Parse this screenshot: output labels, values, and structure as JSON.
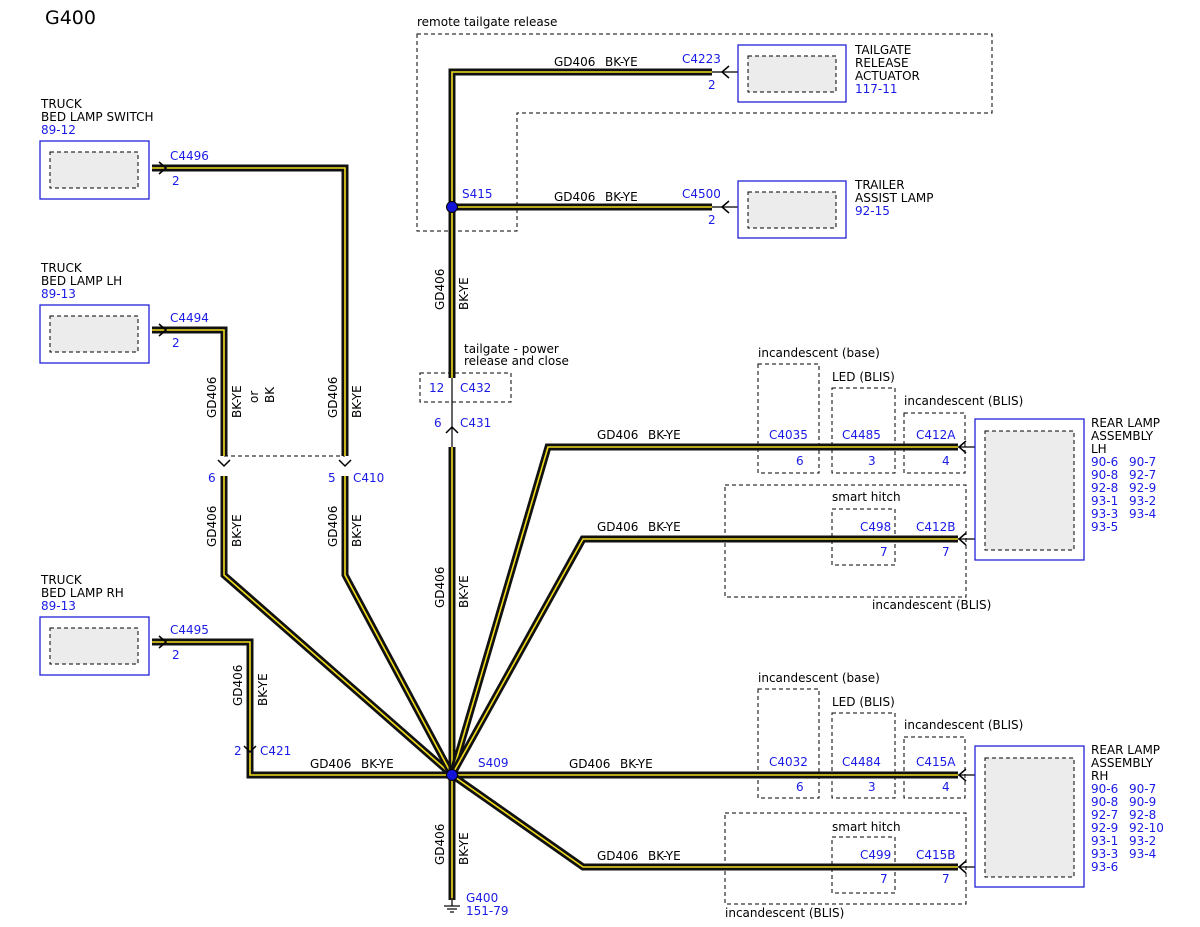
{
  "diagram": {
    "title": "G400",
    "wire_circuit": "GD406",
    "wire_color": "BK-YE",
    "wire_color_alt": "BK",
    "wire_or": "or",
    "accent_blue": "#1a1ae6",
    "wire_yellow": "#f2dc1e"
  },
  "components": {
    "bed_lamp_switch": {
      "name1": "TRUCK",
      "name2": "BED LAMP SWITCH",
      "ref": "89-12",
      "connector": "C4496",
      "pin": "2"
    },
    "bed_lamp_lh": {
      "name1": "TRUCK",
      "name2": "BED LAMP LH",
      "ref": "89-13",
      "connector": "C4494",
      "pin": "2"
    },
    "bed_lamp_rh": {
      "name1": "TRUCK",
      "name2": "BED LAMP RH",
      "ref": "89-13",
      "connector": "C4495",
      "pin": "2"
    },
    "tailgate_actuator": {
      "name1": "TAILGATE",
      "name2": "RELEASE",
      "name3": "ACTUATOR",
      "ref": "117-11",
      "connector": "C4223",
      "pin": "2"
    },
    "trailer_assist_lamp": {
      "name1": "TRAILER",
      "name2": "ASSIST LAMP",
      "ref": "92-15",
      "connector": "C4500",
      "pin": "2"
    },
    "rear_lamp_lh": {
      "name1": "REAR LAMP",
      "name2": "ASSEMBLY",
      "name3": "LH",
      "refs": [
        "90-6",
        "90-7",
        "90-8",
        "92-7",
        "92-8",
        "92-9",
        "93-1",
        "93-2",
        "93-3",
        "93-4",
        "93-5"
      ]
    },
    "rear_lamp_rh": {
      "name1": "REAR LAMP",
      "name2": "ASSEMBLY",
      "name3": "RH",
      "refs": [
        "90-6",
        "90-7",
        "90-8",
        "90-9",
        "92-7",
        "92-8",
        "92-9",
        "92-10",
        "93-1",
        "93-2",
        "93-3",
        "93-4",
        "93-6"
      ]
    }
  },
  "connectors": {
    "c410": {
      "label": "C410",
      "pin_left": "6",
      "pin_right": "5"
    },
    "c432": {
      "label": "C432",
      "pin": "12"
    },
    "c431": {
      "label": "C431",
      "pin": "6"
    },
    "c421": {
      "label": "C421",
      "pin": "2"
    },
    "lh_upper": {
      "c1": "C4035",
      "p1": "6",
      "c2": "C4485",
      "p2": "3",
      "c3": "C412A",
      "p3": "4"
    },
    "lh_lower": {
      "c1": "C498",
      "p1": "7",
      "c2": "C412B",
      "p2": "7"
    },
    "rh_upper": {
      "c1": "C4032",
      "p1": "6",
      "c2": "C4484",
      "p2": "3",
      "c3": "C415A",
      "p3": "4"
    },
    "rh_lower": {
      "c1": "C499",
      "p1": "7",
      "c2": "C415B",
      "p2": "7"
    }
  },
  "splices": {
    "s415": "S415",
    "s409": "S409"
  },
  "ground": {
    "label": "G400",
    "ref": "151-79"
  },
  "options": {
    "remote_tailgate": "remote tailgate release",
    "tailgate_power_1": "tailgate - power",
    "tailgate_power_2": "release and close",
    "incandescent_base": "incandescent (base)",
    "led_blis": "LED (BLIS)",
    "incandescent_blis": "incandescent (BLIS)",
    "smart_hitch": "smart hitch"
  }
}
